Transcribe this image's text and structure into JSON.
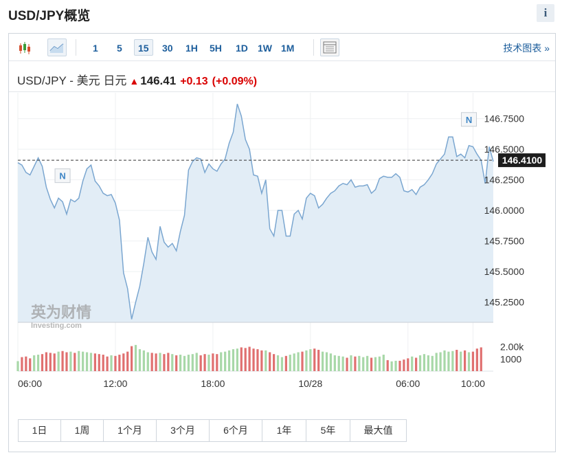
{
  "header": {
    "title": "USD/JPY概览",
    "info_label": "i"
  },
  "toolbar": {
    "intervals": [
      "1",
      "5",
      "15",
      "30",
      "1H",
      "5H",
      "1D",
      "1W",
      "1M"
    ],
    "active_interval": "15",
    "tech_chart_link": "技术图表 »"
  },
  "quote": {
    "pair": "USD/JPY - 美元 日元",
    "price": "146.41",
    "change": "+0.13",
    "change_pct": "(+0.09%)",
    "up_color": "#d90000"
  },
  "watermark": {
    "brand": "英为财情",
    "sub": "Investing.com"
  },
  "periods": [
    "1日",
    "1周",
    "1个月",
    "3个月",
    "6个月",
    "1年",
    "5年",
    "最大值"
  ],
  "chart_data": {
    "type": "area",
    "y_ticks": [
      "146.7500",
      "146.5000",
      "146.2500",
      "146.0000",
      "145.7500",
      "145.5000",
      "145.2500"
    ],
    "y_tick_values": [
      146.75,
      146.5,
      146.25,
      146.0,
      145.75,
      145.5,
      145.25
    ],
    "ylim": [
      145.085,
      146.905
    ],
    "x_ticks": [
      "06:00",
      "12:00",
      "18:00",
      "10/28",
      "06:00",
      "10:00"
    ],
    "x_tick_index": [
      0,
      24,
      48,
      72,
      96,
      112
    ],
    "current_value": 146.41,
    "current_label": "146.4100",
    "series_color": "#7aa6d0",
    "fill_color": "#e2edf6",
    "values": [
      146.39,
      146.37,
      146.31,
      146.29,
      146.36,
      146.43,
      146.36,
      146.19,
      146.09,
      146.02,
      146.1,
      146.07,
      145.97,
      146.09,
      146.07,
      146.1,
      146.24,
      146.34,
      146.37,
      146.24,
      146.2,
      146.14,
      146.12,
      146.13,
      146.06,
      145.92,
      145.49,
      145.36,
      145.11,
      145.25,
      145.38,
      145.57,
      145.78,
      145.66,
      145.6,
      145.87,
      145.74,
      145.7,
      145.73,
      145.67,
      145.83,
      145.96,
      146.33,
      146.4,
      146.43,
      146.42,
      146.31,
      146.38,
      146.34,
      146.32,
      146.38,
      146.42,
      146.55,
      146.64,
      146.87,
      146.77,
      146.58,
      146.5,
      146.29,
      146.28,
      146.14,
      146.25,
      145.85,
      145.79,
      146.0,
      146.0,
      145.79,
      145.79,
      145.97,
      146.0,
      145.93,
      146.1,
      146.14,
      146.12,
      146.02,
      146.05,
      146.1,
      146.14,
      146.16,
      146.2,
      146.22,
      146.21,
      146.25,
      146.19,
      146.2,
      146.2,
      146.21,
      146.14,
      146.17,
      146.26,
      146.28,
      146.27,
      146.27,
      146.3,
      146.27,
      146.16,
      146.15,
      146.17,
      146.13,
      146.19,
      146.21,
      146.25,
      146.3,
      146.38,
      146.42,
      146.46,
      146.6,
      146.6,
      146.44,
      146.46,
      146.43,
      146.53,
      146.52,
      146.46,
      146.41,
      146.22,
      146.52,
      146.4
    ],
    "volume_ticks": [
      "2.00k",
      "1000"
    ],
    "volume_tick_values": [
      2000,
      1000
    ],
    "volume_max": 2650,
    "volume_up_color": "#a8d8a8",
    "volume_down_color": "#e07070",
    "volume": [
      820,
      1150,
      1200,
      1050,
      1300,
      1350,
      1400,
      1550,
      1500,
      1450,
      1600,
      1650,
      1550,
      1600,
      1500,
      1650,
      1600,
      1550,
      1500,
      1450,
      1400,
      1350,
      1200,
      1300,
      1250,
      1350,
      1450,
      1600,
      2050,
      2150,
      1800,
      1700,
      1550,
      1500,
      1450,
      1500,
      1400,
      1500,
      1400,
      1300,
      1350,
      1250,
      1350,
      1400,
      1500,
      1300,
      1400,
      1350,
      1450,
      1400,
      1550,
      1600,
      1700,
      1800,
      1850,
      1950,
      1900,
      2000,
      1850,
      1800,
      1700,
      1700,
      1550,
      1400,
      1300,
      1150,
      1250,
      1350,
      1450,
      1550,
      1600,
      1700,
      1800,
      1850,
      1750,
      1600,
      1550,
      1450,
      1300,
      1250,
      1200,
      1100,
      1300,
      1200,
      1250,
      1150,
      1250,
      1100,
      1150,
      1200,
      1350,
      900,
      800,
      850,
      850,
      950,
      1050,
      1200,
      1100,
      1300,
      1400,
      1300,
      1250,
      1500,
      1550,
      1700,
      1600,
      1650,
      1750,
      1600,
      1700,
      1550,
      1600,
      1850,
      1950
    ]
  }
}
